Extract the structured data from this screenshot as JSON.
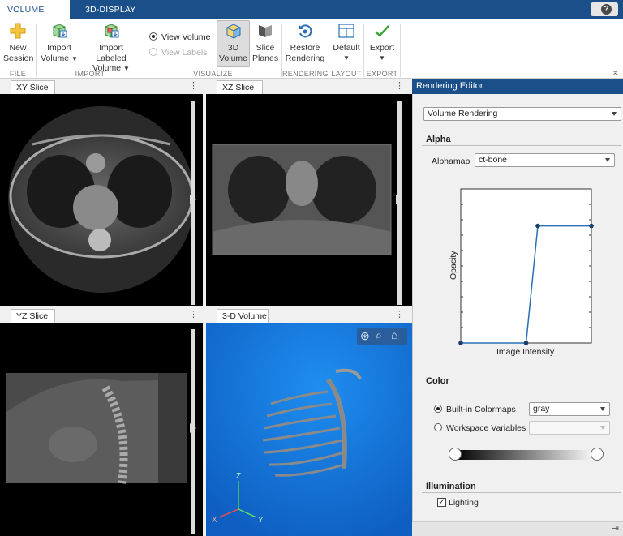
{
  "tabs": [
    {
      "label": "VOLUME VIEWER",
      "active": true
    },
    {
      "label": "3D-DISPLAY",
      "active": false
    }
  ],
  "help": {
    "label": "?"
  },
  "ribbon": {
    "file": {
      "section": "FILE",
      "new_session": {
        "line1": "New",
        "line2": "Session",
        "icon": "plus-icon"
      }
    },
    "import": {
      "section": "IMPORT",
      "import_volume": {
        "line1": "Import",
        "line2": "Volume",
        "icon": "import-volume-icon"
      },
      "import_labeled": {
        "line1": "Import Labeled",
        "line2": "Volume",
        "icon": "import-labeled-volume-icon"
      }
    },
    "visualize": {
      "section": "VISUALIZE",
      "view_volume": "View Volume",
      "view_labels": "View Labels",
      "volume_3d": {
        "line1": "3D",
        "line2": "Volume",
        "icon": "cube-icon"
      },
      "slice_planes": {
        "line1": "Slice",
        "line2": "Planes",
        "icon": "slice-planes-icon"
      }
    },
    "rendering": {
      "section": "RENDERING",
      "restore": {
        "line1": "Restore",
        "line2": "Rendering",
        "icon": "restore-icon"
      }
    },
    "layout": {
      "section": "LAYOUT",
      "default": {
        "line1": "Default",
        "icon": "layout-grid-icon"
      }
    },
    "export": {
      "section": "EXPORT",
      "export": {
        "line1": "Export",
        "icon": "checkmark-icon"
      }
    }
  },
  "panels": {
    "xy": {
      "title": "XY Slice"
    },
    "xz": {
      "title": "XZ Slice"
    },
    "yz": {
      "title": "YZ Slice"
    },
    "vol3d": {
      "title": "3-D Volume"
    }
  },
  "axes_labels": {
    "z": "Z",
    "x": "X",
    "y": "Y"
  },
  "editor": {
    "title": "Rendering Editor",
    "mode": "Volume Rendering",
    "alpha": {
      "heading": "Alpha",
      "alphamap_label": "Alphamap",
      "alphamap_value": "ct-bone",
      "ylabel": "Opacity",
      "xlabel": "Image Intensity",
      "curve": [
        [
          0,
          0
        ],
        [
          0.5,
          0
        ],
        [
          0.59,
          0.76
        ],
        [
          1,
          0.76
        ]
      ]
    },
    "color": {
      "heading": "Color",
      "builtin_label": "Built-in Colormaps",
      "builtin_value": "gray",
      "workspace_label": "Workspace Variables",
      "workspace_value": "",
      "selected": "builtin"
    },
    "illumination": {
      "heading": "Illumination",
      "lighting_label": "Lighting",
      "lighting_checked": true
    }
  },
  "colors": {
    "accent": "#1b4f8a",
    "volume_bg": "#1574d8",
    "curve": "#2a6fb5"
  }
}
